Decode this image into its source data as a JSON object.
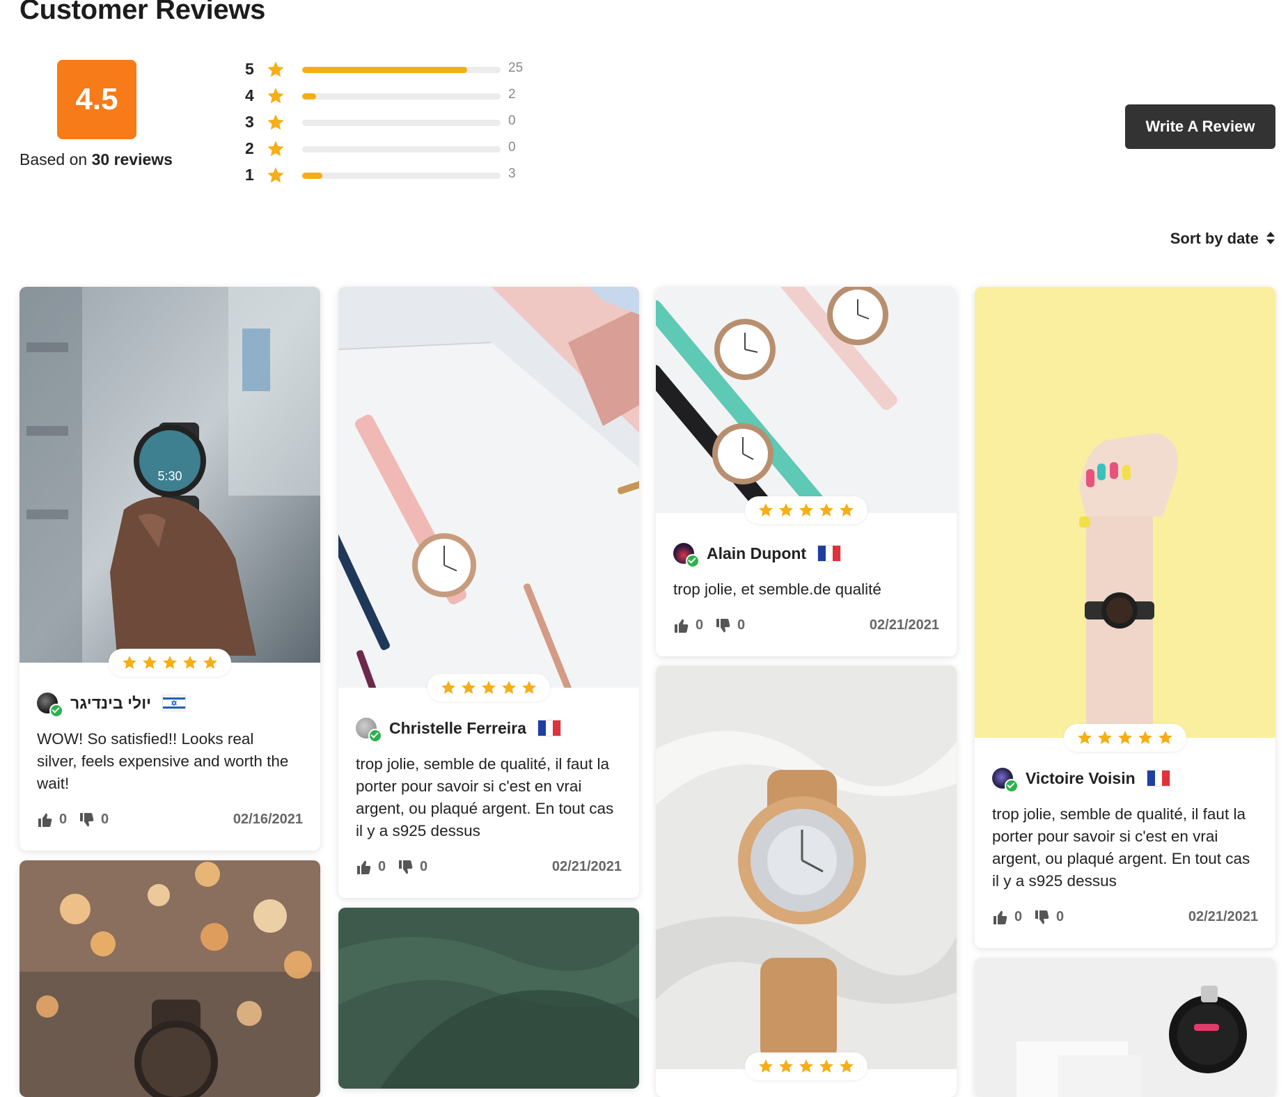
{
  "header": {
    "title": "Customer Reviews",
    "average": "4.5",
    "based_on_prefix": "Based on",
    "based_on_count": "30 reviews"
  },
  "breakdown": [
    {
      "stars": "5",
      "count": "25",
      "fraction": 0.83
    },
    {
      "stars": "4",
      "count": "2",
      "fraction": 0.07
    },
    {
      "stars": "3",
      "count": "0",
      "fraction": 0
    },
    {
      "stars": "2",
      "count": "0",
      "fraction": 0
    },
    {
      "stars": "1",
      "count": "3",
      "fraction": 0.1
    }
  ],
  "actions": {
    "write_review": "Write A Review",
    "sort_label": "Sort by date"
  },
  "colors": {
    "score_badge": "#f77b18",
    "star": "#f5ae15",
    "button": "#333333",
    "verified": "#2bb24c"
  },
  "reviews": [
    {
      "name": "יולי בינדיגר",
      "flag": "israel-flag",
      "rating": 5,
      "text": "WOW! So satisfied!! Looks real silver, feels expensive and worth the wait!",
      "likes": "0",
      "dislikes": "0",
      "date": "02/16/2021"
    },
    {
      "name": "Christelle Ferreira",
      "flag": "france-flag",
      "rating": 5,
      "text": "trop jolie, semble de qualité, il faut la porter pour savoir si c'est en vrai argent, ou plaqué argent. En tout cas il y a s925 dessus",
      "likes": "0",
      "dislikes": "0",
      "date": "02/21/2021"
    },
    {
      "name": "Alain Dupont",
      "flag": "france-flag",
      "rating": 5,
      "text": "trop jolie, et semble.de qualité",
      "likes": "0",
      "dislikes": "0",
      "date": "02/21/2021"
    },
    {
      "name": "Victoire Voisin",
      "flag": "france-flag",
      "rating": 5,
      "text": "trop jolie, semble de qualité, il faut la porter pour savoir si c'est en vrai argent, ou plaqué argent. En tout cas il y a s925 dessus",
      "likes": "0",
      "dislikes": "0",
      "date": "02/21/2021"
    }
  ]
}
